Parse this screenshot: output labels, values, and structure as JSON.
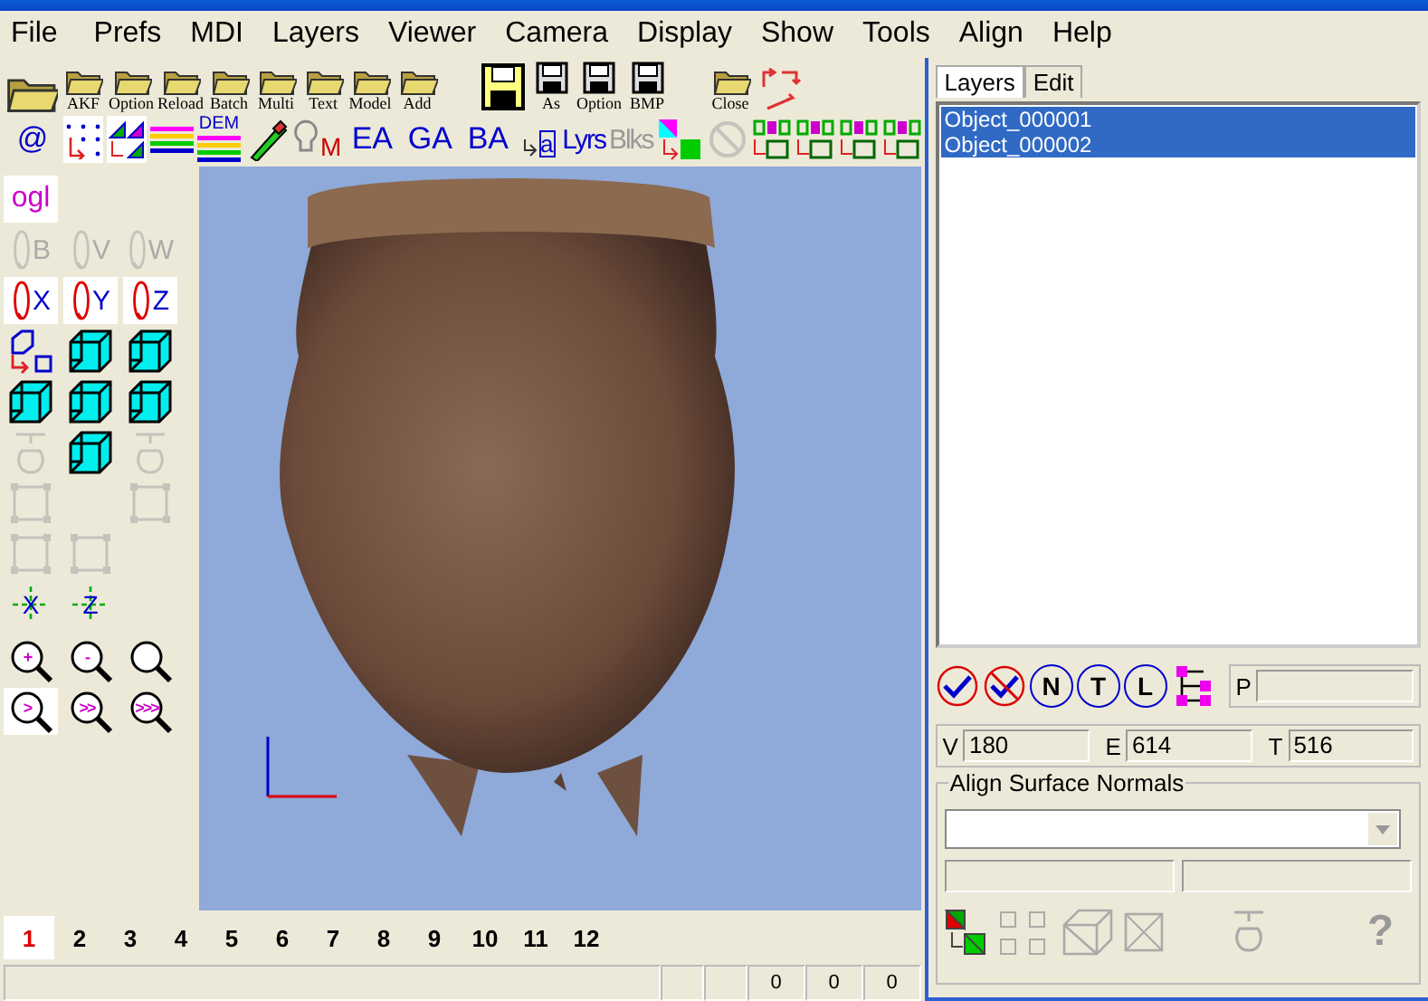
{
  "menu": [
    "File",
    "Prefs",
    "MDI",
    "Layers",
    "Viewer",
    "Camera",
    "Display",
    "Show",
    "Tools",
    "Align",
    "Help"
  ],
  "toolbar_1": [
    [
      {
        "kind": "folder-big"
      },
      {
        "kind": "folder",
        "label": "AKF"
      },
      {
        "kind": "folder",
        "label": "Option"
      },
      {
        "kind": "folder",
        "label": "Reload"
      },
      {
        "kind": "folder",
        "label": "Batch"
      },
      {
        "kind": "folders",
        "label": "Multi"
      },
      {
        "kind": "folder",
        "label": "Text"
      },
      {
        "kind": "folder",
        "label": "Model"
      },
      {
        "kind": "folder",
        "label": "Add"
      }
    ],
    [
      {
        "kind": "disk-big"
      },
      {
        "kind": "disk",
        "label": "As"
      },
      {
        "kind": "disk",
        "label": "Option"
      },
      {
        "kind": "disk",
        "label": "BMP"
      }
    ],
    [
      {
        "kind": "folder",
        "label": "Close"
      },
      {
        "kind": "arrows"
      }
    ]
  ],
  "toolbar_2": [
    {
      "kind": "text",
      "text": "@",
      "pressed": false,
      "disabled": false
    },
    {
      "kind": "dots",
      "pressed": true,
      "disabled": false
    },
    {
      "kind": "triangles",
      "pressed": true,
      "disabled": false
    },
    {
      "kind": "stripes",
      "pressed": false,
      "disabled": false
    },
    {
      "kind": "stripes",
      "text": "DEM",
      "pressed": false,
      "disabled": false
    },
    {
      "kind": "pencil",
      "pressed": false,
      "disabled": false
    },
    {
      "kind": "bulb",
      "text": "M",
      "pressed": false,
      "disabled": false
    },
    {
      "kind": "text",
      "text": "EA",
      "pressed": false,
      "disabled": false
    },
    {
      "kind": "text",
      "text": "GA",
      "pressed": false,
      "disabled": false
    },
    {
      "kind": "text",
      "text": "BA",
      "pressed": false,
      "disabled": false
    },
    {
      "kind": "boxes",
      "text": "a",
      "pressed": false,
      "disabled": false
    },
    {
      "kind": "sub",
      "text": "Lyrs",
      "pressed": false,
      "disabled": false
    },
    {
      "kind": "sub",
      "text": "Blks",
      "pressed": false,
      "disabled": true
    },
    {
      "kind": "swap",
      "pressed": false,
      "disabled": false
    },
    {
      "kind": "nosign",
      "pressed": false,
      "disabled": true
    },
    {
      "kind": "grid",
      "pressed": false,
      "disabled": false
    },
    {
      "kind": "grid",
      "pressed": false,
      "disabled": false
    },
    {
      "kind": "grid",
      "pressed": false,
      "disabled": false
    },
    {
      "kind": "grid",
      "pressed": false,
      "disabled": false
    }
  ],
  "left_tools": [
    [
      {
        "kind": "text",
        "glyph": "ogl",
        "pressed": true,
        "disabled": false
      }
    ],
    [
      {
        "kind": "rotate",
        "glyph": "B",
        "pressed": false,
        "disabled": true
      },
      {
        "kind": "rotate",
        "glyph": "V",
        "pressed": false,
        "disabled": true
      },
      {
        "kind": "rotate",
        "glyph": "W",
        "pressed": false,
        "disabled": true
      }
    ],
    [
      {
        "kind": "rotate",
        "glyph": "X",
        "pressed": true,
        "disabled": false
      },
      {
        "kind": "rotate",
        "glyph": "Y",
        "pressed": true,
        "disabled": false
      },
      {
        "kind": "rotate",
        "glyph": "Z",
        "pressed": true,
        "disabled": false
      }
    ],
    [
      {
        "kind": "scale",
        "pressed": false,
        "disabled": false
      },
      {
        "kind": "cube",
        "pressed": false,
        "disabled": false
      },
      {
        "kind": "cube",
        "pressed": false,
        "disabled": false
      }
    ],
    [
      {
        "kind": "cube",
        "pressed": false,
        "disabled": false
      },
      {
        "kind": "cube",
        "pressed": false,
        "disabled": false
      },
      {
        "kind": "cube",
        "pressed": false,
        "disabled": false
      }
    ],
    [
      {
        "kind": "pot",
        "pressed": false,
        "disabled": true
      },
      {
        "kind": "cube",
        "pressed": false,
        "disabled": false
      },
      {
        "kind": "pot",
        "pressed": false,
        "disabled": true
      }
    ],
    [
      {
        "kind": "frame",
        "pressed": false,
        "disabled": true
      },
      {
        "kind": "frame",
        "pressed": false,
        "disabled": true
      }
    ],
    [
      {
        "kind": "frame",
        "pressed": false,
        "disabled": true
      },
      {
        "kind": "frame",
        "pressed": false,
        "disabled": true
      }
    ],
    [
      {
        "kind": "axis",
        "glyph": "X",
        "pressed": false,
        "disabled": false
      },
      {
        "kind": "axis",
        "glyph": "Z",
        "pressed": false,
        "disabled": false
      }
    ],
    [
      {
        "kind": "zoom",
        "glyph": "+",
        "pressed": false,
        "disabled": false
      },
      {
        "kind": "zoom",
        "glyph": "-",
        "pressed": false,
        "disabled": false
      },
      {
        "kind": "zoom",
        "pressed": false,
        "disabled": false
      }
    ],
    [
      {
        "kind": "zoom",
        "glyph": ">",
        "pressed": true,
        "disabled": false
      },
      {
        "kind": "zoom",
        "glyph": ">>",
        "pressed": false,
        "disabled": false
      },
      {
        "kind": "zoom",
        "glyph": ">>>",
        "pressed": false,
        "disabled": false
      }
    ]
  ],
  "page_tabs": [
    {
      "label": "1",
      "selected": true
    },
    {
      "label": "2",
      "selected": false
    },
    {
      "label": "3",
      "selected": false
    },
    {
      "label": "4",
      "selected": false
    },
    {
      "label": "5",
      "selected": false
    },
    {
      "label": "6",
      "selected": false
    },
    {
      "label": "7",
      "selected": false
    },
    {
      "label": "8",
      "selected": false
    },
    {
      "label": "9",
      "selected": false
    },
    {
      "label": "10",
      "selected": false
    },
    {
      "label": "11",
      "selected": false
    },
    {
      "label": "12",
      "selected": false
    }
  ],
  "status_cells": [
    "0",
    "0",
    "0"
  ],
  "panel": {
    "tabs": [
      {
        "label": "Layers",
        "selected": true
      },
      {
        "label": "Edit",
        "selected": false
      }
    ],
    "layers": [
      {
        "name": "Object_000001",
        "selected": true
      },
      {
        "name": "Object_000002",
        "selected": true
      }
    ],
    "tools": [
      {
        "kind": "check"
      },
      {
        "kind": "uncheck"
      },
      {
        "kind": "circle",
        "glyph": "N"
      },
      {
        "kind": "circle",
        "glyph": "T"
      },
      {
        "kind": "circle",
        "glyph": "L"
      },
      {
        "kind": "tree"
      }
    ],
    "p_label": "P",
    "counts": [
      {
        "label": "V",
        "value": "180"
      },
      {
        "label": "E",
        "value": "614"
      },
      {
        "label": "T",
        "value": "516"
      }
    ],
    "group_title": "Align Surface Normals",
    "bottom_tools": [
      {
        "kind": "colorswap",
        "disabled": false
      },
      {
        "kind": "squares",
        "disabled": true
      },
      {
        "kind": "wirecube",
        "disabled": true
      },
      {
        "kind": "crossbox",
        "disabled": true
      },
      {
        "kind": "pot",
        "disabled": true
      },
      {
        "kind": "help",
        "glyph": "?",
        "disabled": true
      }
    ]
  }
}
